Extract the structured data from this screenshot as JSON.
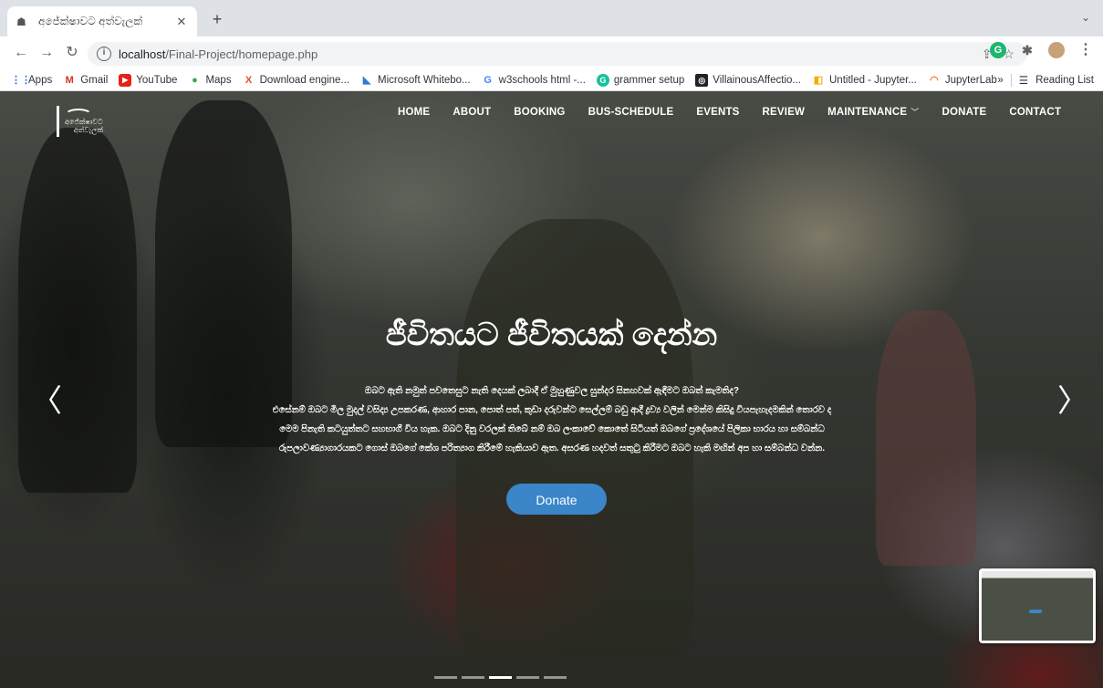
{
  "browser": {
    "tab_title": "අජේක්ෂාවට අත්වැලක්",
    "url_host": "localhost",
    "url_path": "/Final-Project/homepage.php",
    "bookmarks": [
      {
        "label": "Apps",
        "icon": "apps-grid-icon"
      },
      {
        "label": "Gmail",
        "icon": "gmail-icon"
      },
      {
        "label": "YouTube",
        "icon": "youtube-icon"
      },
      {
        "label": "Maps",
        "icon": "maps-icon"
      },
      {
        "label": "Download engine...",
        "icon": "x-icon"
      },
      {
        "label": "Microsoft Whitebo...",
        "icon": "whiteboard-icon"
      },
      {
        "label": "w3schools html -...",
        "icon": "google-icon"
      },
      {
        "label": "grammer setup",
        "icon": "grammarly-icon"
      },
      {
        "label": "VillainousAffectio...",
        "icon": "replit-icon"
      },
      {
        "label": "Untitled - Jupyter...",
        "icon": "colab-icon"
      },
      {
        "label": "JupyterLab",
        "icon": "jupyter-icon"
      }
    ],
    "reading_list": "Reading List"
  },
  "site": {
    "logo_text_line1": "අජේක්ෂාවට",
    "logo_text_line2": "අත්වැලක්",
    "nav": {
      "home": "HOME",
      "about": "ABOUT",
      "booking": "BOOKING",
      "bus_schedule": "BUS-SCHEDULE",
      "events": "EVENTS",
      "review": "REVIEW",
      "maintenance": "MAINTENANCE",
      "donate": "DONATE",
      "contact": "CONTACT"
    },
    "hero": {
      "title": "ජීවිතයට ජීවිතයක් දෙන්න",
      "line1": "ඔබට ඇති නමුත් පවතෙසුට නැති දෙයක් ලබාදී ඒ මුහුණුවල සුන්දර සිනහවක් ඇඳීමට ඔබත් කැමතිද?",
      "line2": "එසේනම් ඔබට මිල මුදල් වසිද්‍ය උපකරණ, ආහාර පාන, පොත් පත්, කුඩා දරුවන්ට සෙල්ලම් බඩු ආදී ද්‍රව්‍ය වලින් මෙන්ම කිසිදු වියපැහැදමකින් තොරව ද",
      "line3": "මෙම පිනැති කටයුත්තට සහභාගී විය හැක. ඔබට දිනු වරලක් තිබේ නම් ඔබ ලංකාවේ කොතේ සිටියත් ඔබගේ ප්‍රදේශයේ පිලිකා භාරය හා සම්බන්ධ",
      "line4": "රුපලාවණ්‍යාගාරයකට ගොස් ඔබගේ කේශ පරිත්‍යාග කිරීමේ හැකියාව ඇත. අසරණ හදවත් සතුටු කිරීමට ඔබට හැකි මඟින් අප හා සම්බන්ධ වන්න.",
      "donate_button": "Donate"
    }
  }
}
